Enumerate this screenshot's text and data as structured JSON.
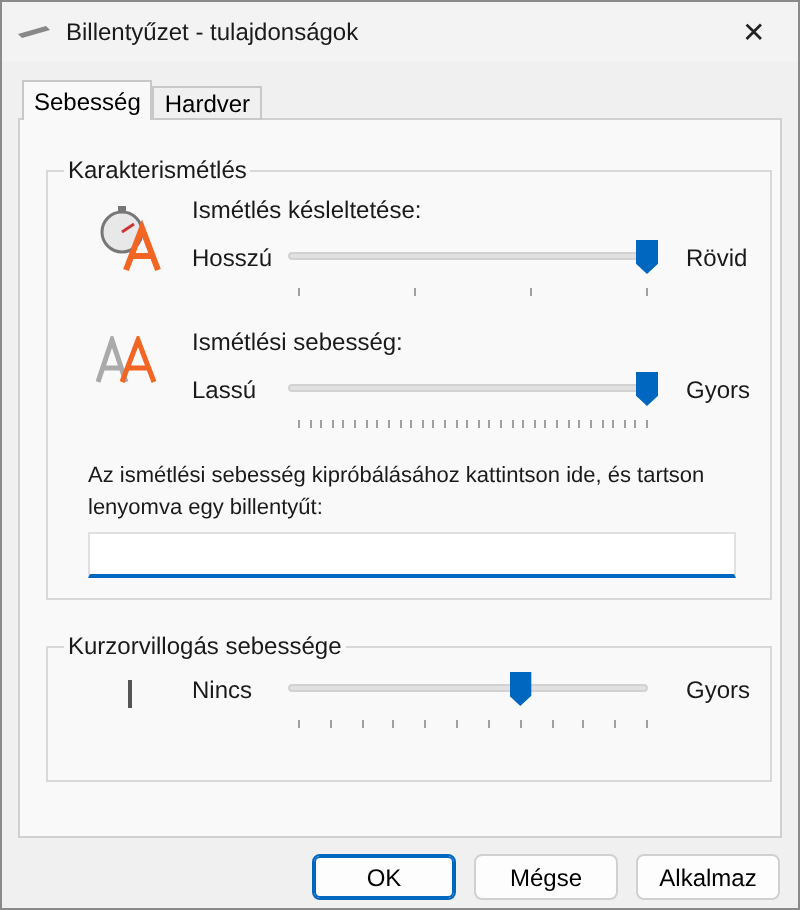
{
  "window": {
    "title": "Billentyűzet - tulajdonságok",
    "close": "✕"
  },
  "tabs": [
    {
      "label": "Sebesség",
      "selected": true
    },
    {
      "label": "Hardver",
      "selected": false
    }
  ],
  "groups": [
    {
      "title": "Karakterismétlés",
      "sliders": [
        {
          "kind": "delay",
          "label": "Ismétlés késleltetése:",
          "left": "Hosszú",
          "right": "Rövid",
          "level": 1
        },
        {
          "kind": "rate",
          "label": "Ismétlési sebesség:",
          "left": "Lassú",
          "right": "Gyors",
          "level": 1
        }
      ],
      "test": {
        "label": "Az ismétlési sebesség kipróbálásához kattintson ide, és tartson lenyomva egy billentyűt:"
      }
    },
    {
      "title": "Kurzorvillogás sebessége",
      "sliders": [
        {
          "kind": "blink",
          "left": "Nincs",
          "right": "Gyors",
          "level": 0.636
        }
      ]
    }
  ],
  "buttons": [
    {
      "label": "OK",
      "default": true
    },
    {
      "label": "Mégse",
      "default": false
    },
    {
      "label": "Alkalmaz",
      "default": false
    }
  ]
}
